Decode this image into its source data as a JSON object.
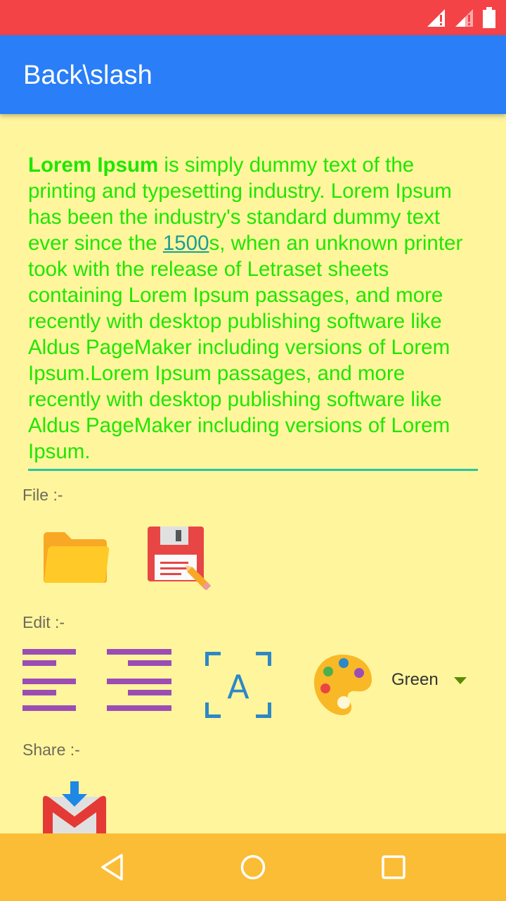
{
  "app": {
    "title": "Back\\slash"
  },
  "editor": {
    "bold": "Lorem Ipsum",
    "text1": " is simply dummy text of the printing and typesetting industry. Lorem Ipsum has been the industry's standard dummy text ever since the ",
    "link": "1500",
    "text2": "s, when an unknown printer took with the release of Letraset sheets containing Lorem Ipsum passages, and more recently with desktop publishing software like Aldus PageMaker including versions of Lorem Ipsum.Lorem Ipsum passages, and more recently with desktop publishing software like Aldus PageMaker including versions of Lorem Ipsum."
  },
  "sections": {
    "file": "File :-",
    "edit": "Edit :-",
    "share": "Share :-"
  },
  "color_select": {
    "value": "Green"
  },
  "icons": {
    "file": [
      "folder-icon",
      "save-icon"
    ],
    "edit": [
      "align-left-icon",
      "align-right-icon",
      "font-size-icon",
      "palette-icon"
    ],
    "share": [
      "gmail-icon"
    ],
    "nav": [
      "back-icon",
      "home-icon",
      "recents-icon"
    ]
  },
  "colors": {
    "status_bar": "#f44347",
    "app_bar": "#2a7ef7",
    "background": "#fff59d",
    "text": "#1ee600",
    "nav_bar": "#fbbd36"
  }
}
